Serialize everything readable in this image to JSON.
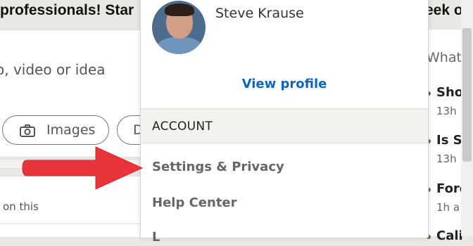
{
  "feed": {
    "banner_text": "professionals! Star",
    "share_placeholder": "o, video or idea",
    "images_label": "Images",
    "video_label_partial": "D",
    "post_text": "on this"
  },
  "right_panel": {
    "banner_text": "eek o",
    "header": "What",
    "items": [
      {
        "title": "Sho",
        "time": "13h"
      },
      {
        "title": "Is S",
        "time": "13h"
      },
      {
        "title": "Fore",
        "time": "1h a"
      },
      {
        "title": "Cali",
        "time": ""
      }
    ]
  },
  "menu": {
    "user_name": "Steve Krause",
    "view_profile_label": "View profile",
    "section_header": "ACCOUNT",
    "items": [
      {
        "label": "Settings & Privacy"
      },
      {
        "label": "Help Center"
      },
      {
        "label": "L"
      }
    ]
  },
  "colors": {
    "link_blue": "#0a66c2",
    "arrow_red": "#e8343a",
    "section_bg": "#f3f2ef"
  },
  "icons": {
    "images_icon": "camera-icon",
    "annotation": "red-arrow-icon"
  }
}
